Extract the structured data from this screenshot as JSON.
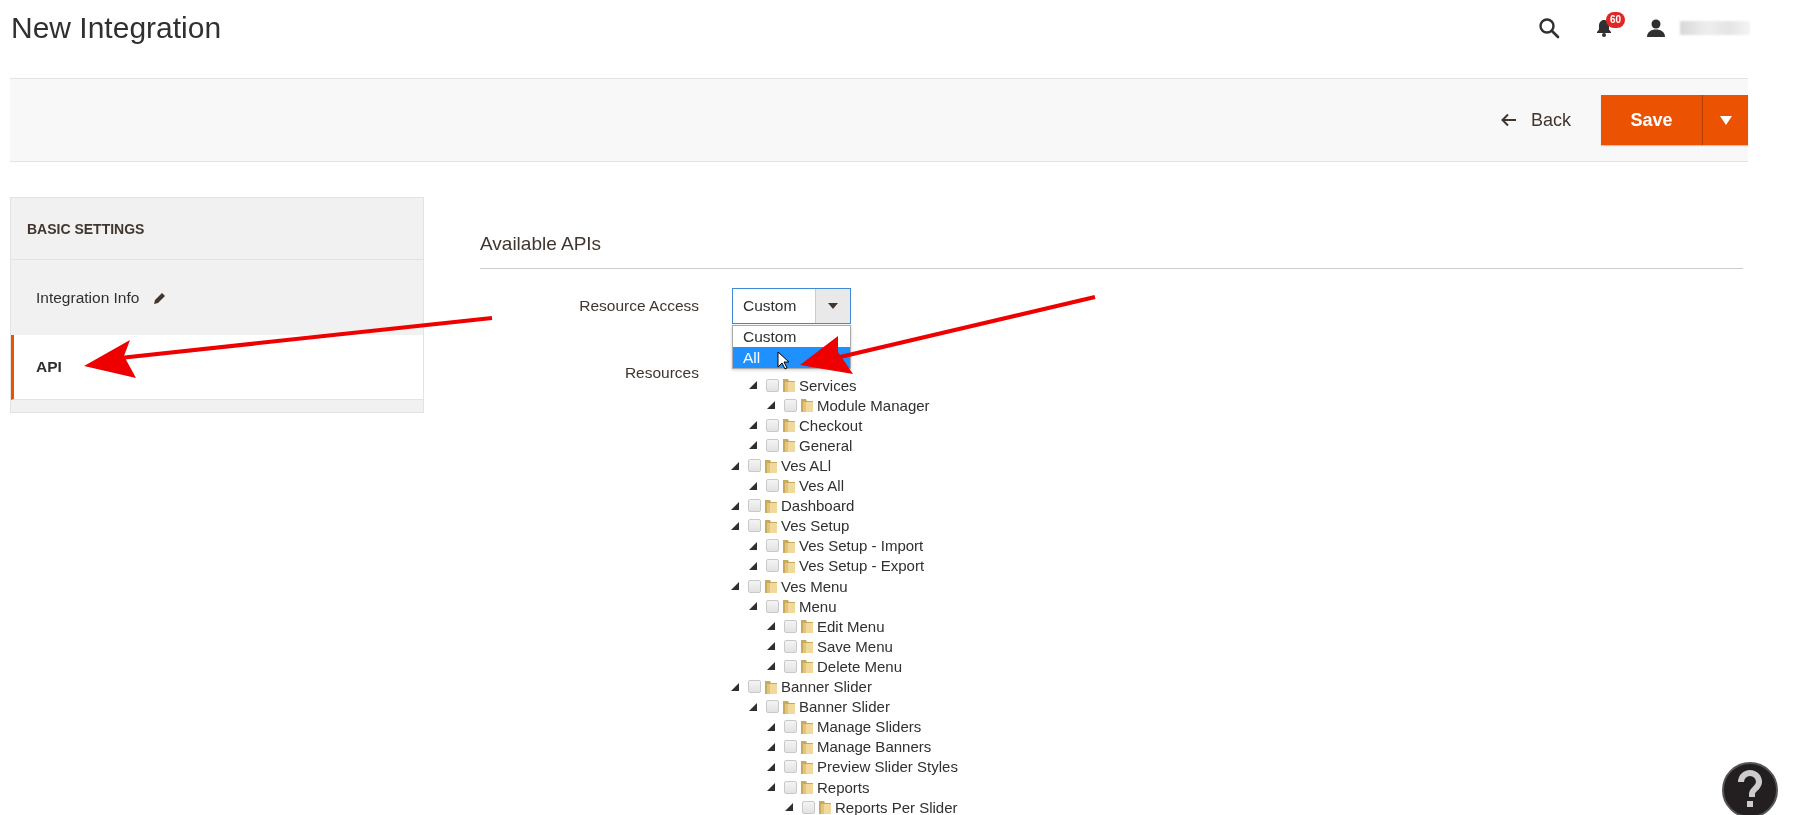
{
  "page_title": "New Integration",
  "header": {
    "notification_count": "60"
  },
  "actions": {
    "back": "Back",
    "save": "Save"
  },
  "sidebar": {
    "heading": "BASIC SETTINGS",
    "items": [
      {
        "label": "Integration Info",
        "selected": false,
        "editable": true
      },
      {
        "label": "API",
        "selected": true,
        "editable": false
      }
    ]
  },
  "section_title": "Available APIs",
  "resource_access": {
    "label": "Resource Access",
    "value": "Custom",
    "options": [
      {
        "label": "Custom",
        "highlighted": false
      },
      {
        "label": "All",
        "highlighted": true
      }
    ]
  },
  "resources": {
    "label": "Resources",
    "tree": [
      {
        "children": [
          {
            "label": "Services",
            "checked": false,
            "children": [
              {
                "label": "Module Manager",
                "checked": false
              }
            ]
          },
          {
            "label": "Checkout",
            "checked": false
          },
          {
            "label": "General",
            "checked": false
          }
        ]
      },
      {
        "label": "Ves ALl",
        "checked": false,
        "children": [
          {
            "label": "Ves All",
            "checked": false
          }
        ]
      },
      {
        "label": "Dashboard",
        "checked": false
      },
      {
        "label": "Ves Setup",
        "checked": false,
        "children": [
          {
            "label": "Ves Setup - Import",
            "checked": false
          },
          {
            "label": "Ves Setup - Export",
            "checked": false
          }
        ]
      },
      {
        "label": "Ves Menu",
        "checked": false,
        "children": [
          {
            "label": "Menu",
            "checked": false,
            "children": [
              {
                "label": "Edit Menu",
                "checked": false
              },
              {
                "label": "Save Menu",
                "checked": false
              },
              {
                "label": "Delete Menu",
                "checked": false
              }
            ]
          }
        ]
      },
      {
        "label": "Banner Slider",
        "checked": false,
        "children": [
          {
            "label": "Banner Slider",
            "checked": false,
            "children": [
              {
                "label": "Manage Sliders",
                "checked": false
              },
              {
                "label": "Manage Banners",
                "checked": false
              },
              {
                "label": "Preview Slider Styles",
                "checked": false
              },
              {
                "label": "Reports",
                "checked": false,
                "children": [
                  {
                    "label": "Reports Per Slider",
                    "checked": false
                  }
                ]
              }
            ]
          }
        ]
      }
    ]
  }
}
